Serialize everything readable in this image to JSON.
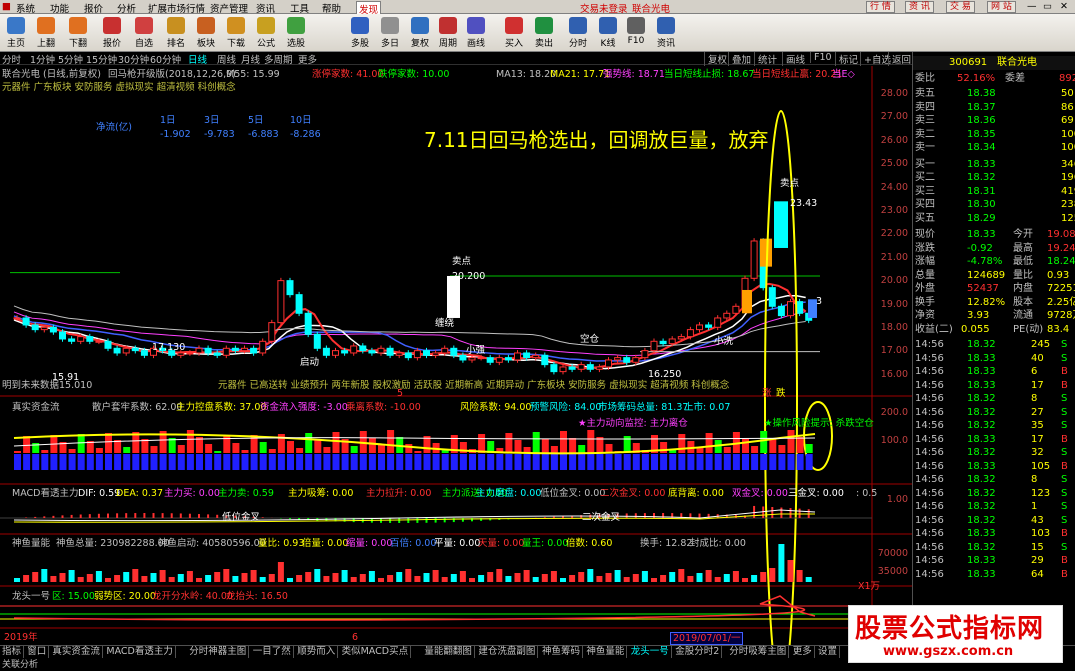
{
  "menubar": {
    "items": [
      "系统",
      "功能",
      "报价",
      "分析",
      "扩展市场行情",
      "资产管理",
      "资讯",
      "工具",
      "帮助"
    ],
    "discover": "发现",
    "login_status": "交易未登录",
    "stock_name": "联合光电",
    "right_buttons": [
      "行 情",
      "资 讯",
      "交 易",
      "网 站"
    ]
  },
  "toolbar": {
    "buttons": [
      {
        "label": "主页",
        "icon": "home-icon",
        "color": "#3a78c8"
      },
      {
        "label": "上翻",
        "icon": "page-up-icon",
        "color": "#e07020"
      },
      {
        "label": "下翻",
        "icon": "page-down-icon",
        "color": "#e07020"
      },
      {
        "label": "报价",
        "icon": "quote-icon",
        "color": "#c83030"
      },
      {
        "label": "自选",
        "icon": "favorites-icon",
        "color": "#d04040"
      },
      {
        "label": "排名",
        "icon": "rank-icon",
        "color": "#c89020"
      },
      {
        "label": "板块",
        "icon": "sector-icon",
        "color": "#c86020"
      },
      {
        "label": "下载",
        "icon": "download-icon",
        "color": "#d09020"
      },
      {
        "label": "公式",
        "icon": "formula-icon",
        "color": "#c8a020"
      },
      {
        "label": "选股",
        "icon": "stock-picker-icon",
        "color": "#40a040"
      },
      {
        "label": "多股",
        "icon": "multi-stock-icon",
        "color": "#3060c0"
      },
      {
        "label": "多日",
        "icon": "multi-day-icon",
        "color": "#909090"
      },
      {
        "label": "复权",
        "icon": "adjust-icon",
        "color": "#3070c0"
      },
      {
        "label": "周期",
        "icon": "period-icon",
        "color": "#c03030"
      },
      {
        "label": "画线",
        "icon": "draw-line-icon",
        "color": "#5050c0"
      },
      {
        "label": "买入",
        "icon": "buy-icon",
        "color": "#d03030"
      },
      {
        "label": "卖出",
        "icon": "sell-icon",
        "color": "#209040"
      },
      {
        "label": "分时",
        "icon": "intraday-icon",
        "color": "#3060b0"
      },
      {
        "label": "K线",
        "icon": "kline-icon",
        "color": "#3060b0"
      },
      {
        "label": "F10",
        "icon": "f10-icon",
        "color": "#606060"
      },
      {
        "label": "资讯",
        "icon": "news-icon",
        "color": "#3060b0"
      }
    ]
  },
  "periodbar": {
    "periods": [
      "分时",
      "1分钟",
      "5分钟",
      "15分钟",
      "30分钟",
      "60分钟",
      "日线",
      "周线",
      "月线",
      "多周期",
      "更多"
    ],
    "selected": "日线",
    "right": [
      "复权",
      "叠加",
      "统计",
      "画线",
      "F10",
      "标记",
      "+自选",
      "返回"
    ]
  },
  "main_panel": {
    "header_name": "联合光电 (日线,前复权)",
    "indicator": "回马枪开级版(2018,12,26,9)",
    "m55": "M55: 15.99",
    "limit_up": "涨停家数: 41.00",
    "limit_down": "跌停家数: 10.00",
    "ma13": "MA13: 18.20",
    "ma21": "MA21: 17.71",
    "strong": "强势线: 18.71",
    "stop_short": "当日短线止损: 18.67",
    "stop_day": "当日短线止赢: 20.21",
    "tail": "当E◇",
    "concepts": "元器件 广东板块 安防服务 虚拟现实 超清视频 科创概念",
    "flow_label": "净流(亿)",
    "flow_headers": [
      "1日",
      "3日",
      "5日",
      "10日"
    ],
    "flow_values": [
      "-1.902",
      "-9.783",
      "-6.883",
      "-8.286"
    ],
    "annotation": "7.11日回马枪选出，回调放巨量，放弃",
    "labels": {
      "sell_top": "卖点",
      "high_price": "23.43",
      "sell_mid": "卖点",
      "mid_price": "20.200",
      "jiying": "缠绕",
      "empty": "空仓",
      "xiaoxi": "小洗",
      "low_price": "17.130",
      "left_low": "15.91",
      "bottom_low": "16.250",
      "start": "启动",
      "bottom_left": "明到未来数据15.010",
      "xiaoqiang": "小强",
      "concept_bottom": "元器件 已高送转 业绩预升 两年新股 股权激励 活跃股 近期新高 近期异动 广东板块 安防服务 虚拟现实 超清视频 科创概念",
      "zhang": "涨",
      "die": "跌"
    },
    "y_ticks": [
      "28.00",
      "27.00",
      "26.00",
      "25.00",
      "24.00",
      "23.00",
      "22.00",
      "21.00",
      "20.00",
      "19.00",
      "18.00",
      "17.00",
      "16.00"
    ],
    "number_marker": "3"
  },
  "fund_panel": {
    "title": "真实资金流",
    "retail": "散户套牢系数: 62.00",
    "main_ctrl": "主力控盘系数: 37.00",
    "inflow": "资金流入强度: -3.00",
    "leave": "乘离系数: -10.00",
    "risk": "风险系数: 94.00",
    "warn": "预警风险: 84.00",
    "chips": "市场筹码总量: 81.37",
    "up": "上市: 0.07",
    "monitor": "★主力动向监控: 主力离仓",
    "risk_tip": "★操作风险提示: 杀跌空仓",
    "y_ticks": [
      "200.0",
      "100.0"
    ]
  },
  "macd_panel": {
    "title": "MACD看透主力",
    "dif": "DIF: 0.59",
    "dea": "DEA: 0.37",
    "main_sell": "主力买: 0.00",
    "main_buy": "主力卖: 0.59",
    "absorb": "主力吸筹: 0.00",
    "pull": "主力拉升: 0.00",
    "dispatch": "主力派送: 0.00",
    "grind": "主力磨盘: 0.00",
    "low_cross": "低位金叉: 0.00",
    "second_cross": "二次金叉: 0.00",
    "bottom_div": "底背离: 0.00",
    "double_cross": "双金叉: 0.00",
    "triple_cross": "三金叉: 0.00",
    "extra": ": 0.5",
    "label_low": "低位金叉",
    "label_second": "二次金叉",
    "y_tick": "1.00"
  },
  "volume_panel": {
    "title": "神鱼量能",
    "total": "神鱼总量: 230982288.00",
    "start": "神鱼启动: 40580596.00",
    "ratio": "量比: 0.93",
    "double": "倍量: 0.00",
    "shrink": "缩量: 0.00",
    "hundred": "百倍: 0.00",
    "flat": "平量: 0.00",
    "sky": "天量: 0.00",
    "king": "量王: 0.00",
    "multiple": "倍数: 0.60",
    "turnover": "换手: 12.82",
    "compare": "封成比: 0.00",
    "y_ticks": [
      "70000",
      "35000"
    ],
    "unit": "X1万"
  },
  "dragon_panel": {
    "title": "龙头一号",
    "zone": "区: 15.00",
    "weak": "弱势区: 20.00",
    "start": "龙开分水岭: 40.00",
    "head": "龙抬头: 16.50"
  },
  "xaxis": {
    "year": "2019年",
    "mid": "6",
    "date_box": "2019/07/01/一",
    "marker": "5"
  },
  "right_panel": {
    "code": "300691",
    "name": "联合光电",
    "wb_label": "委比",
    "wb_value": "52.16%",
    "wc_label": "委差",
    "wc_value": "892",
    "asks": [
      {
        "label": "卖五",
        "price": "18.38",
        "vol": "50"
      },
      {
        "label": "卖四",
        "price": "18.37",
        "vol": "86"
      },
      {
        "label": "卖三",
        "price": "18.36",
        "vol": "69"
      },
      {
        "label": "卖二",
        "price": "18.35",
        "vol": "100"
      },
      {
        "label": "卖一",
        "price": "18.34",
        "vol": "100"
      }
    ],
    "bids": [
      {
        "label": "买一",
        "price": "18.33",
        "vol": "346"
      },
      {
        "label": "买二",
        "price": "18.32",
        "vol": "196"
      },
      {
        "label": "买三",
        "price": "18.31",
        "vol": "419"
      },
      {
        "label": "买四",
        "price": "18.30",
        "vol": "238"
      },
      {
        "label": "买五",
        "price": "18.29",
        "vol": "125"
      }
    ],
    "stats": [
      {
        "l1": "现价",
        "v1": "18.33",
        "l2": "今开",
        "v2": "19.08"
      },
      {
        "l1": "涨跌",
        "v1": "-0.92",
        "l2": "最高",
        "v2": "19.24"
      },
      {
        "l1": "涨幅",
        "v1": "-4.78%",
        "l2": "最低",
        "v2": "18.24"
      },
      {
        "l1": "总量",
        "v1": "124689",
        "l2": "量比",
        "v2": "0.93"
      },
      {
        "l1": "外盘",
        "v1": "52437",
        "l2": "内盘",
        "v2": "72251"
      },
      {
        "l1": "换手",
        "v1": "12.82%",
        "l2": "股本",
        "v2": "2.25亿"
      },
      {
        "l1": "净资",
        "v1": "3.93",
        "l2": "流通",
        "v2": "9728万"
      },
      {
        "l1": "收益(二)",
        "v1": "0.055",
        "l2": "PE(动)",
        "v2": "83.4"
      }
    ],
    "ticks": [
      {
        "t": "14:56",
        "p": "18.32",
        "v": "245",
        "s": "S"
      },
      {
        "t": "14:56",
        "p": "18.33",
        "v": "40",
        "s": "S"
      },
      {
        "t": "14:56",
        "p": "18.33",
        "v": "6",
        "s": "B"
      },
      {
        "t": "14:56",
        "p": "18.33",
        "v": "17",
        "s": "B"
      },
      {
        "t": "14:56",
        "p": "18.32",
        "v": "8",
        "s": "S"
      },
      {
        "t": "14:56",
        "p": "18.32",
        "v": "27",
        "s": "S"
      },
      {
        "t": "14:56",
        "p": "18.32",
        "v": "35",
        "s": "S"
      },
      {
        "t": "14:56",
        "p": "18.33",
        "v": "17",
        "s": "B"
      },
      {
        "t": "14:56",
        "p": "18.32",
        "v": "32",
        "s": "S"
      },
      {
        "t": "14:56",
        "p": "18.33",
        "v": "105",
        "s": "B"
      },
      {
        "t": "14:56",
        "p": "18.32",
        "v": "8",
        "s": "S"
      },
      {
        "t": "14:56",
        "p": "18.32",
        "v": "123",
        "s": "S"
      },
      {
        "t": "14:56",
        "p": "18.32",
        "v": "1",
        "s": "S"
      },
      {
        "t": "14:56",
        "p": "18.32",
        "v": "43",
        "s": "S"
      },
      {
        "t": "14:56",
        "p": "18.33",
        "v": "103",
        "s": "B"
      },
      {
        "t": "14:56",
        "p": "18.32",
        "v": "15",
        "s": "S"
      },
      {
        "t": "14:56",
        "p": "18.33",
        "v": "29",
        "s": "B"
      },
      {
        "t": "14:56",
        "p": "18.33",
        "v": "64",
        "s": "B"
      }
    ]
  },
  "bottom_tabs": [
    "指标",
    "窗口",
    "真实资金流",
    "MACD看透主力",
    "分时神器主图",
    "一目了然",
    "顺势而入",
    "类似MACD买点",
    "量能翻翻图",
    "建仓洗盘副图",
    "神鱼筹码",
    "神鱼量能",
    "龙头一号",
    "金股分时2",
    "分时吸筹主图",
    "更多",
    "设置"
  ],
  "bottom_selected": "龙头一号",
  "bottom_row2": "关联分析",
  "watermark": {
    "title": "股票公式指标网",
    "url": "www.gszx.com.cn"
  }
}
